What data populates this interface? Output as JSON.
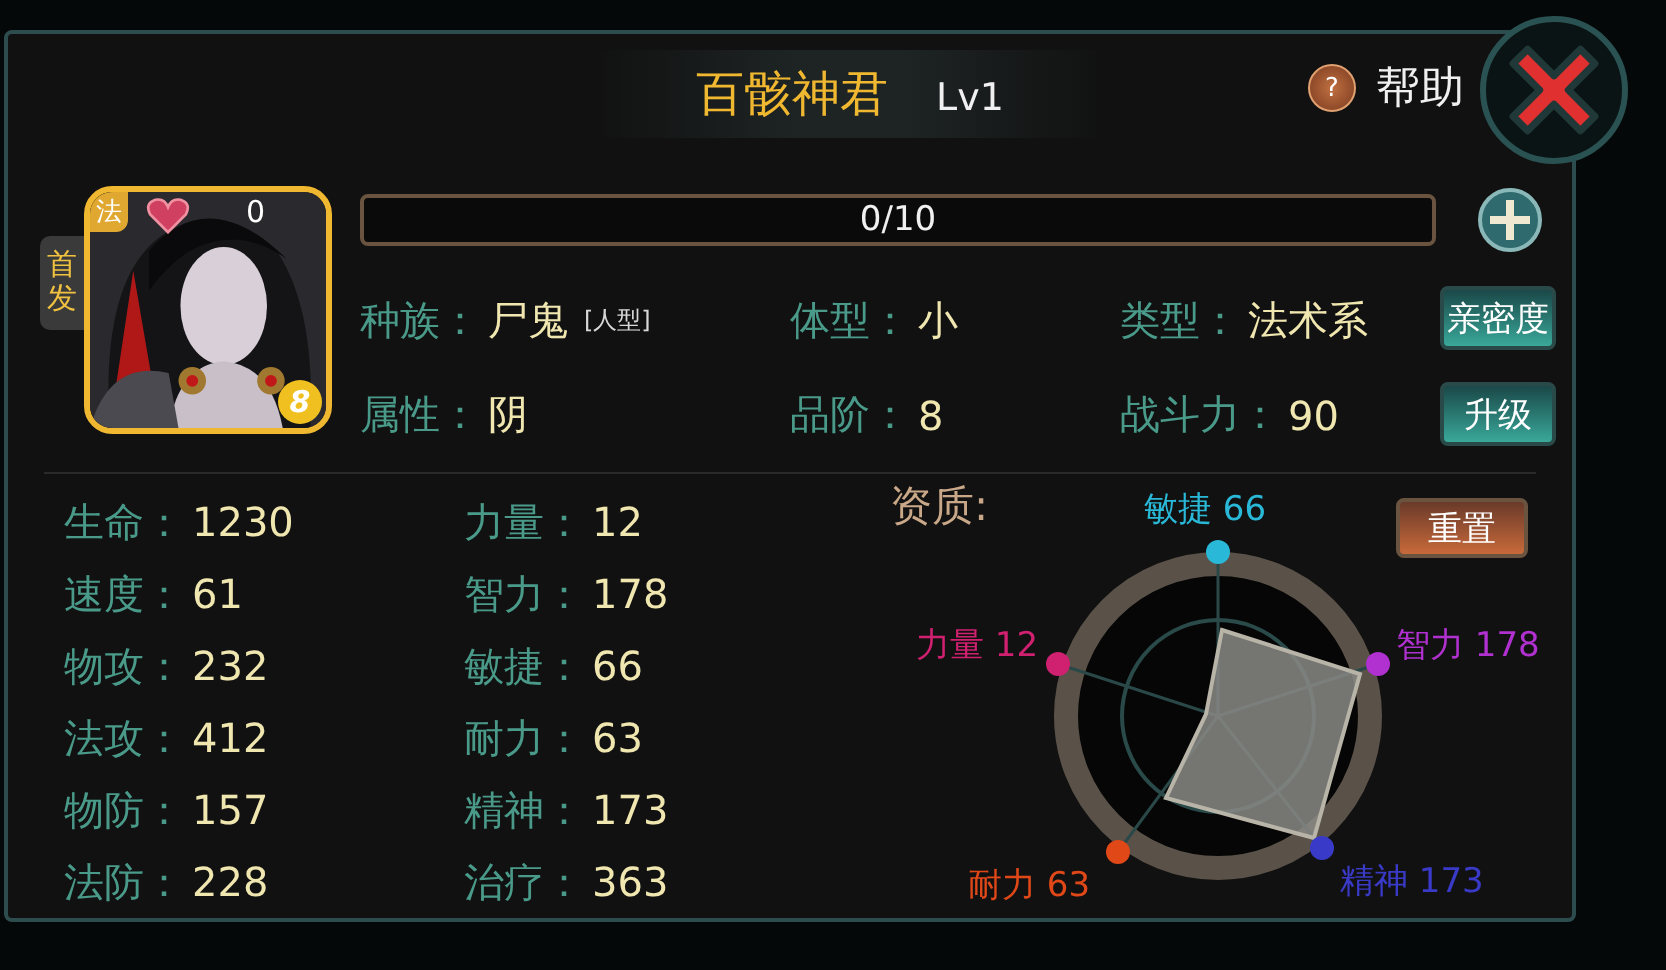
{
  "title": {
    "name": "百骸神君",
    "level": "Lv1"
  },
  "help": {
    "icon": "?",
    "label": "帮助"
  },
  "card": {
    "class_badge": "法",
    "hearts": "0",
    "grade": "8",
    "tab": "首发"
  },
  "progress": {
    "text": "0/10",
    "level": 0
  },
  "info": [
    {
      "label": "种族：",
      "value": "尸鬼",
      "note": "[人型]"
    },
    {
      "label": "体型：",
      "value": "小"
    },
    {
      "label": "类型：",
      "value": "法术系"
    },
    {
      "label": "属性：",
      "value": "阴"
    },
    {
      "label": "品阶：",
      "value": "8"
    },
    {
      "label": "战斗力：",
      "value": "90"
    }
  ],
  "buttons": {
    "intimacy": "亲密度",
    "upgrade": "升级",
    "reset": "重置"
  },
  "stats": [
    {
      "label": "生命：",
      "value": "1230"
    },
    {
      "label": "速度：",
      "value": "61"
    },
    {
      "label": "物攻：",
      "value": "232"
    },
    {
      "label": "法攻：",
      "value": "412"
    },
    {
      "label": "物防：",
      "value": "157"
    },
    {
      "label": "法防：",
      "value": "228"
    },
    {
      "label": "力量：",
      "value": "12"
    },
    {
      "label": "智力：",
      "value": "178"
    },
    {
      "label": "敏捷：",
      "value": "66"
    },
    {
      "label": "耐力：",
      "value": "63"
    },
    {
      "label": "精神：",
      "value": "173"
    },
    {
      "label": "治疗：",
      "value": "363"
    }
  ],
  "aptitude": {
    "title": "资质:",
    "axes": [
      {
        "label": "敏捷 66",
        "color": "#2ab8d8"
      },
      {
        "label": "智力 178",
        "color": "#b030d0"
      },
      {
        "label": "精神 173",
        "color": "#3a3ac8"
      },
      {
        "label": "耐力 63",
        "color": "#e04818"
      },
      {
        "label": "力量 12",
        "color": "#d02070"
      }
    ]
  }
}
